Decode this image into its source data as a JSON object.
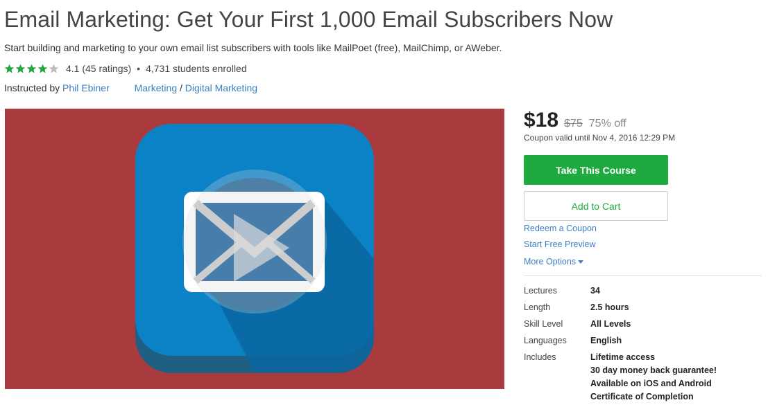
{
  "course": {
    "title": "Email Marketing: Get Your First 1,000 Email Subscribers Now",
    "subtitle": "Start building and marketing to your own email list subscribers with tools like MailPoet (free), MailChimp, or AWeber.",
    "rating": {
      "stars": 4.1,
      "text": "4.1 (45 ratings)",
      "separator": "•",
      "enrolled": "4,731 students enrolled",
      "star_color": "#1faa3f",
      "empty_star_color": "#bbbbbb"
    },
    "instructor": {
      "prefix": "Instructed by",
      "name": "Phil Ebiner"
    },
    "categories": {
      "primary": "Marketing",
      "sep": "/",
      "secondary": "Digital Marketing"
    },
    "preview": {
      "background_color": "#a93b3e",
      "icon": "email-play-icon"
    }
  },
  "sidebar": {
    "price_now": "$18",
    "price_was": "$75",
    "discount": "75% off",
    "coupon_valid": "Coupon valid until Nov 4, 2016 12:29 PM",
    "take_course": "Take This Course",
    "add_to_cart": "Add to Cart",
    "redeem_coupon": "Redeem a Coupon",
    "free_preview": "Start Free Preview",
    "more_options": "More Options",
    "accent_color": "#1faa3f",
    "link_color": "#3d7ec2",
    "details": [
      {
        "label": "Lectures",
        "value": [
          "34"
        ]
      },
      {
        "label": "Length",
        "value": [
          "2.5 hours"
        ]
      },
      {
        "label": "Skill Level",
        "value": [
          "All Levels"
        ]
      },
      {
        "label": "Languages",
        "value": [
          "English"
        ]
      },
      {
        "label": "Includes",
        "value": [
          "Lifetime access",
          "30 day money back guarantee!",
          "Available on iOS and Android",
          "Certificate of Completion"
        ]
      }
    ]
  }
}
